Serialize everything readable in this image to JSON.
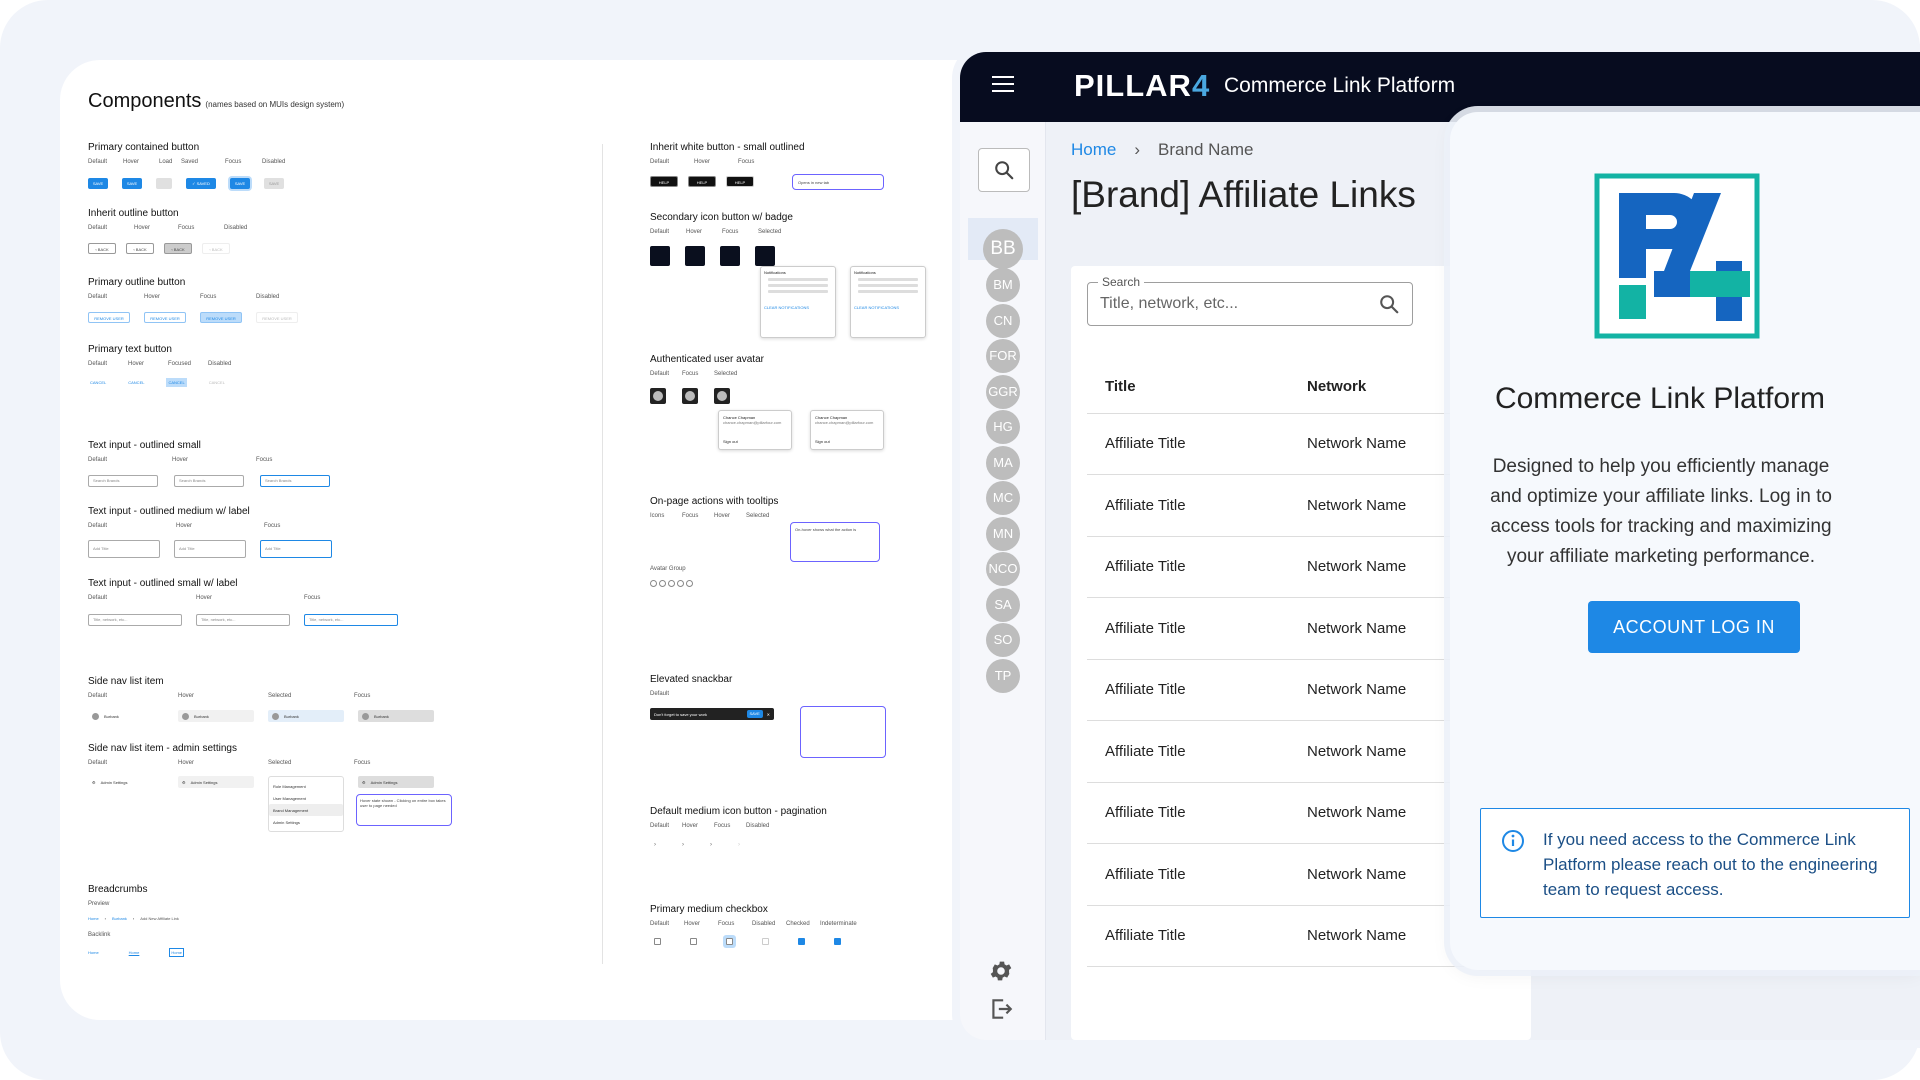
{
  "components": {
    "title": "Components",
    "subtitle": "(names based on MUIs design system)",
    "left_sections": [
      {
        "title": "Primary contained button",
        "states": [
          "Default",
          "Hover",
          "Load",
          "Saved",
          "Focus",
          "Disabled"
        ]
      },
      {
        "title": "Inherit outline button",
        "states": [
          "Default",
          "Hover",
          "Focus",
          "Disabled"
        ]
      },
      {
        "title": "Primary outline button",
        "states": [
          "Default",
          "Hover",
          "Focus",
          "Disabled"
        ]
      },
      {
        "title": "Primary text button",
        "states": [
          "Default",
          "Hover",
          "Focused",
          "Disabled"
        ]
      },
      {
        "title": "Text input - outlined small",
        "states": [
          "Default",
          "Hover",
          "Focus"
        ]
      },
      {
        "title": "Text input - outlined medium w/ label",
        "states": [
          "Default",
          "Hover",
          "Focus"
        ]
      },
      {
        "title": "Text input - outlined small w/ label",
        "states": [
          "Default",
          "Hover",
          "Focus"
        ]
      },
      {
        "title": "Side nav list item",
        "states": [
          "Default",
          "Hover",
          "Selected",
          "Focus"
        ]
      },
      {
        "title": "Side nav list item - admin settings",
        "states": [
          "Default",
          "Hover",
          "Selected",
          "Focus"
        ]
      },
      {
        "title": "Breadcrumbs",
        "states": [
          "Preview"
        ]
      }
    ],
    "right_sections": [
      {
        "title": "Inherit white button - small outlined",
        "states": [
          "Default",
          "Hover",
          "Focus"
        ]
      },
      {
        "title": "Secondary icon button w/ badge",
        "states": [
          "Default",
          "Hover",
          "Focus",
          "Selected"
        ]
      },
      {
        "title": "Authenticated user avatar",
        "states": [
          "Default",
          "Focus",
          "Selected"
        ]
      },
      {
        "title": "On-page actions with tooltips",
        "states": [
          "Icons",
          "Focus",
          "Hover",
          "Selected"
        ]
      },
      {
        "title": "Elevated snackbar",
        "states": [
          "Default"
        ]
      },
      {
        "title": "Default medium icon button - pagination",
        "states": [
          "Default",
          "Hover",
          "Focus",
          "Disabled"
        ]
      },
      {
        "title": "Primary medium checkbox",
        "states": [
          "Default",
          "Hover",
          "Focus",
          "Disabled",
          "Checked",
          "Indeterminate"
        ]
      }
    ],
    "mini": {
      "save": "SAVE",
      "saved": "✓ SAVED",
      "back": "‹ BACK",
      "remove": "REMOVE USER",
      "cancel": "CANCEL",
      "search_brands": "Search Brands",
      "add_title": "Add Title",
      "title_network": "Title, network, etc...",
      "burbank": "Burbank",
      "admin_settings": "Admin Settings",
      "role_mgmt": "Role Management",
      "user_mgmt": "User Management",
      "brand_mgmt": "Brand Management",
      "help": "HELP",
      "opens_new_tab": "Opens in new tab",
      "notifications": "Notifications",
      "clear_notifications": "CLEAR NOTIFICATIONS",
      "user_name": "Chance Chapman",
      "user_email": "chance.chapman@pillarfour.com",
      "sign_out": "Sign out",
      "snackbar": "Don't forget to save your work",
      "snackbar_action": "SAVE",
      "bc_home": "Home",
      "bc_burbank": "Burbank",
      "bc_new": "Add New Affiliate Link",
      "backlink": "Backlink",
      "avatar_group": "Avatar Group",
      "note_tooltip": "On-hover shows what the action is",
      "note_hover": "Hover state shown - Clicking on entire box takes user to page needed"
    }
  },
  "header": {
    "logo_text": "PILLAR",
    "logo_num": "4",
    "app_title": "Commerce Link Platform"
  },
  "sidenav": {
    "avatars": [
      "BB",
      "BM",
      "CN",
      "FOR",
      "GGR",
      "HG",
      "MA",
      "MC",
      "MN",
      "NCO",
      "SA",
      "SO",
      "TP"
    ]
  },
  "breadcrumb": {
    "home": "Home",
    "current": "Brand Name"
  },
  "page_title": "[Brand] Affiliate Links",
  "search": {
    "label": "Search",
    "placeholder": "Title, network, etc..."
  },
  "table": {
    "columns": [
      "Title",
      "Network"
    ],
    "rows": [
      [
        "Affiliate Title",
        "Network Name"
      ],
      [
        "Affiliate Title",
        "Network Name"
      ],
      [
        "Affiliate Title",
        "Network Name"
      ],
      [
        "Affiliate Title",
        "Network Name"
      ],
      [
        "Affiliate Title",
        "Network Name"
      ],
      [
        "Affiliate Title",
        "Network Name"
      ],
      [
        "Affiliate Title",
        "Network Name"
      ],
      [
        "Affiliate Title",
        "Network Name"
      ],
      [
        "Affiliate Title",
        "Network Name"
      ]
    ]
  },
  "modal": {
    "title": "Commerce Link Platform",
    "description": "Designed to help you efficiently manage and optimize your affiliate links. Log in to access tools for tracking and maximizing your affiliate marketing performance.",
    "login_button": "ACCOUNT LOG IN",
    "info": "If you need access to the Commerce Link Platform please reach out to the engineering team to request access."
  },
  "colors": {
    "primary": "#1e88e5",
    "topbar": "#070c1f",
    "logo_teal": "#13b3a4",
    "logo_blue": "#1565c0"
  }
}
